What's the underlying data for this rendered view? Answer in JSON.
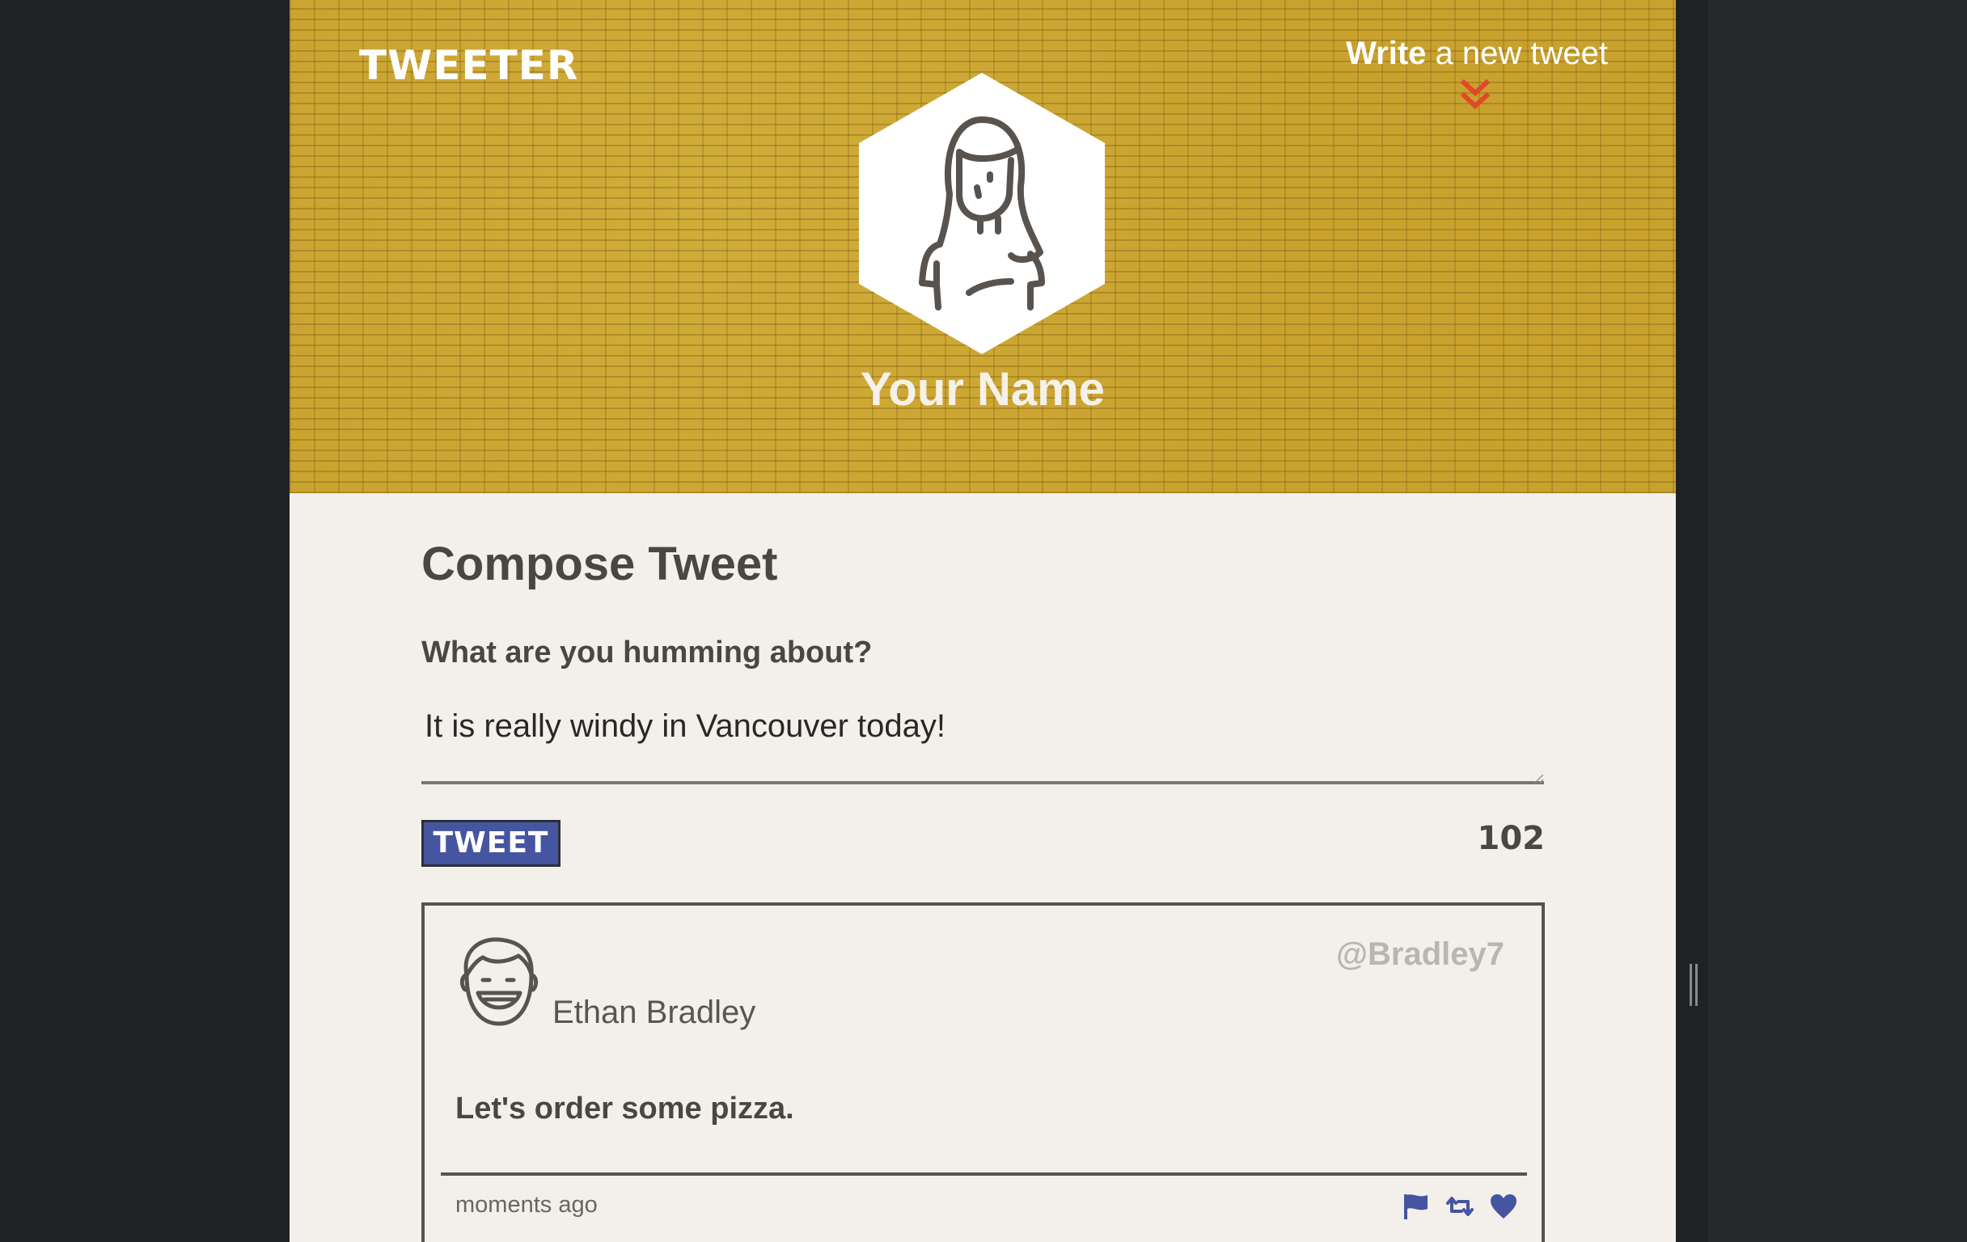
{
  "header": {
    "brand": "TWEETER",
    "compose_link_bold": "Write",
    "compose_link_rest": " a new tweet",
    "user_name": "Your Name"
  },
  "compose": {
    "title": "Compose Tweet",
    "label": "What are you humming about?",
    "input_value": "It is really windy in Vancouver today!",
    "button_label": "TWEET",
    "counter": "102"
  },
  "tweets": [
    {
      "author": "Ethan Bradley",
      "handle": "@Bradley7",
      "body": "Let's order some pizza.",
      "time": "moments ago",
      "actions": [
        "flag-icon",
        "retweet-icon",
        "heart-icon"
      ]
    }
  ],
  "colors": {
    "header_gold": "#c9a22e",
    "accent_blue": "#4555a0",
    "chevron_red": "#e2482a",
    "page_bg": "#f3f0ec",
    "text_dark": "#4b4641"
  }
}
